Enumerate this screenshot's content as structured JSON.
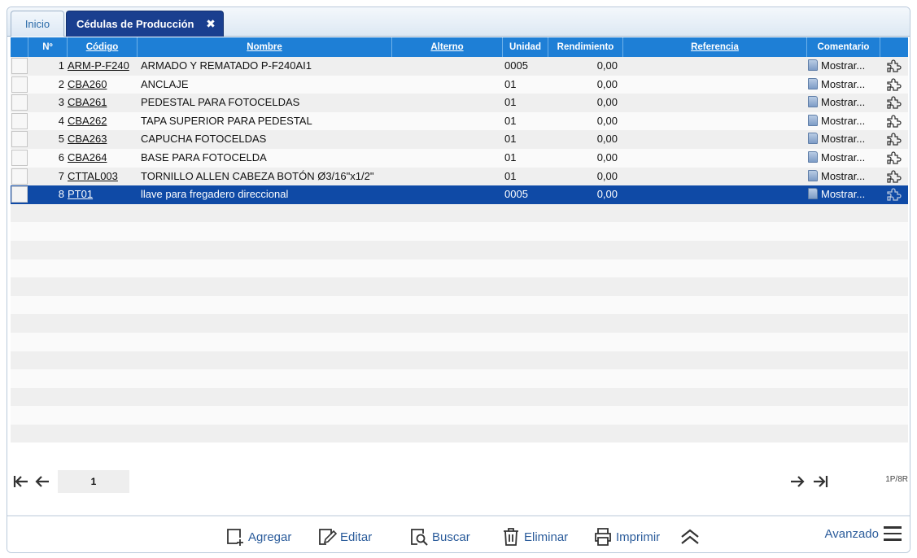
{
  "tabs": {
    "home": "Inicio",
    "active": "Cédulas de Producción",
    "close": "✖"
  },
  "headers": {
    "num": "Nº",
    "codigo": "Código",
    "nombre": "Nombre",
    "alterno": "Alterno",
    "unidad": "Unidad",
    "rendimiento": "Rendimiento",
    "referencia": "Referencia",
    "comentario": "Comentario"
  },
  "rows": [
    {
      "num": "1",
      "code": "ARM-P-F240",
      "name": "ARMADO Y REMATADO P-F240AI1",
      "unit": "0005",
      "yield": "0,00",
      "comment": "Mostrar..."
    },
    {
      "num": "2",
      "code": "CBA260",
      "name": "ANCLAJE",
      "unit": "01",
      "yield": "0,00",
      "comment": "Mostrar..."
    },
    {
      "num": "3",
      "code": "CBA261",
      "name": "PEDESTAL PARA FOTOCELDAS",
      "unit": "01",
      "yield": "0,00",
      "comment": "Mostrar..."
    },
    {
      "num": "4",
      "code": "CBA262",
      "name": "TAPA SUPERIOR PARA PEDESTAL",
      "unit": "01",
      "yield": "0,00",
      "comment": "Mostrar..."
    },
    {
      "num": "5",
      "code": "CBA263",
      "name": "CAPUCHA FOTOCELDAS",
      "unit": "01",
      "yield": "0,00",
      "comment": "Mostrar..."
    },
    {
      "num": "6",
      "code": "CBA264",
      "name": "BASE PARA FOTOCELDA",
      "unit": "01",
      "yield": "0,00",
      "comment": "Mostrar..."
    },
    {
      "num": "7",
      "code": "CTTAL003",
      "name": "TORNILLO ALLEN CABEZA BOTÓN Ø3/16\"x1/2\"",
      "unit": "01",
      "yield": "0,00",
      "comment": "Mostrar..."
    },
    {
      "num": "8",
      "code": "PT01",
      "name": "llave para fregadero direccional",
      "unit": "0005",
      "yield": "0,00",
      "comment": "Mostrar..."
    }
  ],
  "selected_row": 8,
  "pager": {
    "page": "1",
    "count": "1P/8R"
  },
  "toolbar": {
    "add": "Agregar",
    "edit": "Editar",
    "search": "Buscar",
    "delete": "Eliminar",
    "print": "Imprimir",
    "advanced": "Avanzado"
  },
  "colors": {
    "header": "#1e7fd6",
    "selected": "#0f4aa6",
    "tab_active": "#1a3f8f",
    "link": "#2b5c9b"
  }
}
